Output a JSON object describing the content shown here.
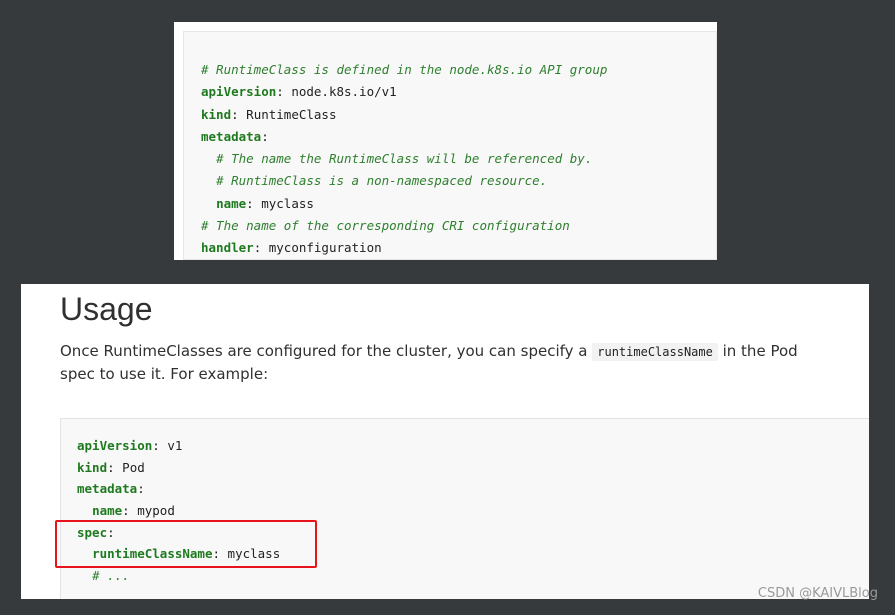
{
  "panel1": {
    "lines": [
      {
        "comment": "# RuntimeClass is defined in the node.k8s.io API group"
      },
      {
        "key": "apiVersion",
        "value": " node.k8s.io/v1"
      },
      {
        "key": "kind",
        "value": " RuntimeClass"
      },
      {
        "key": "metadata",
        "value": ""
      },
      {
        "indent": "  ",
        "comment": "# The name the RuntimeClass will be referenced by."
      },
      {
        "indent": "  ",
        "comment": "# RuntimeClass is a non-namespaced resource."
      },
      {
        "indent": "  ",
        "key": "name",
        "value": " myclass"
      },
      {
        "comment": "# The name of the corresponding CRI configuration"
      },
      {
        "key": "handler",
        "value": " myconfiguration"
      }
    ]
  },
  "usage": {
    "heading": "Usage",
    "para_before": "Once RuntimeClasses are configured for the cluster, you can specify a ",
    "inline_code": "runtimeClassName",
    "para_after": " in the Pod spec to use it. For example:"
  },
  "panel2": {
    "lines": [
      {
        "key": "apiVersion",
        "value": " v1"
      },
      {
        "key": "kind",
        "value": " Pod"
      },
      {
        "key": "metadata",
        "value": ""
      },
      {
        "indent": "  ",
        "key": "name",
        "value": " mypod"
      },
      {
        "key": "spec",
        "value": ""
      },
      {
        "indent": "  ",
        "key": "runtimeClassName",
        "value": " myclass"
      },
      {
        "indent": "  ",
        "comment": "# ..."
      }
    ]
  },
  "watermark": "CSDN @KAIVLBlog",
  "colors": {
    "highlight": "#e8141b",
    "key": "#1f7a1f",
    "comment": "#2f7f2f"
  }
}
